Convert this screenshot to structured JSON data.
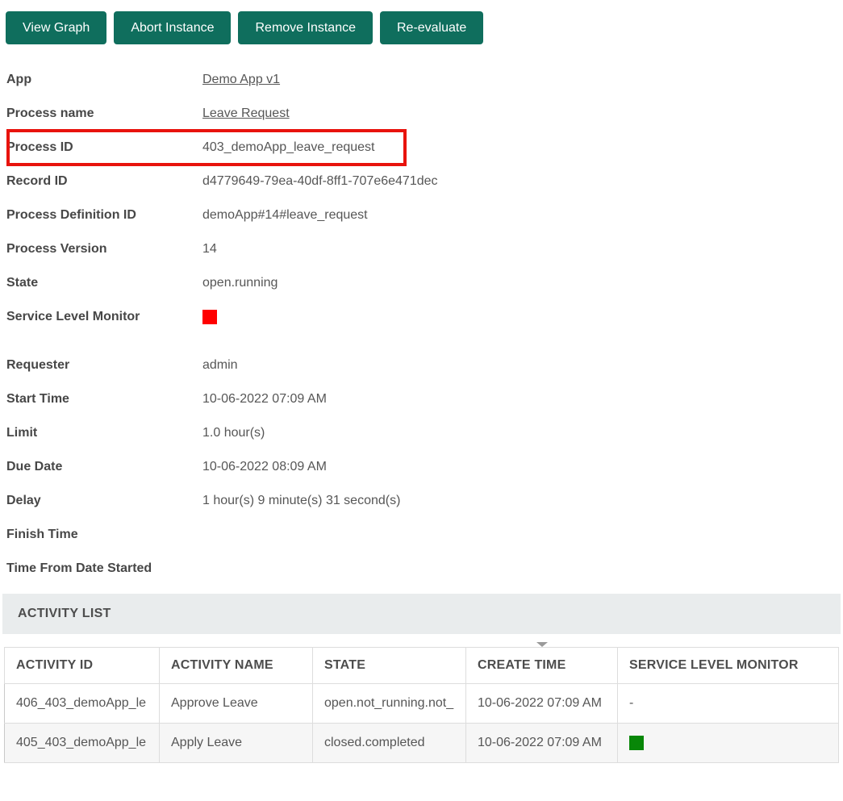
{
  "colors": {
    "accent": "#0f6e5d",
    "annotation_red": "#e8130d",
    "slm_red": "#ff0000",
    "slm_green": "#088708",
    "section_bar_bg": "#e9eced"
  },
  "toolbar": {
    "buttons": [
      "View Graph",
      "Abort Instance",
      "Remove Instance",
      "Re-evaluate"
    ]
  },
  "process_details": {
    "fields": [
      {
        "label": "App",
        "value": "Demo App v1",
        "link": true
      },
      {
        "label": "Process name",
        "value": "Leave Request",
        "link": true
      },
      {
        "label": "Process ID",
        "value": "403_demoApp_leave_request",
        "highlighted": true
      },
      {
        "label": "Record ID",
        "value": "d4779649-79ea-40df-8ff1-707e6e471dec"
      },
      {
        "label": "Process Definition ID",
        "value": "demoApp#14#leave_request"
      },
      {
        "label": "Process Version",
        "value": "14"
      },
      {
        "label": "State",
        "value": "open.running"
      },
      {
        "label": "Service Level Monitor",
        "value": "",
        "indicator_color": "#ff0000"
      },
      {
        "label": "Requester",
        "value": "admin",
        "section_gap": true
      },
      {
        "label": "Start Time",
        "value": "10-06-2022 07:09 AM"
      },
      {
        "label": "Limit",
        "value": "1.0 hour(s)"
      },
      {
        "label": "Due Date",
        "value": "10-06-2022 08:09 AM"
      },
      {
        "label": "Delay",
        "value": "1 hour(s) 9 minute(s) 31 second(s)"
      },
      {
        "label": "Finish Time",
        "value": ""
      },
      {
        "label": "Time From Date Started",
        "value": ""
      }
    ]
  },
  "activity_list": {
    "title": "ACTIVITY LIST",
    "columns": [
      "ACTIVITY ID",
      "ACTIVITY NAME",
      "STATE",
      "CREATE TIME",
      "SERVICE LEVEL MONITOR"
    ],
    "rows": [
      {
        "cells": [
          "406_403_demoApp_le",
          "Approve Leave",
          "open.not_running.not_",
          "10-06-2022 07:09 AM",
          "-"
        ]
      },
      {
        "cells": [
          "405_403_demoApp_le",
          "Apply Leave",
          "closed.completed",
          "10-06-2022 07:09 AM",
          {
            "indicator": "#088708"
          }
        ]
      }
    ]
  }
}
